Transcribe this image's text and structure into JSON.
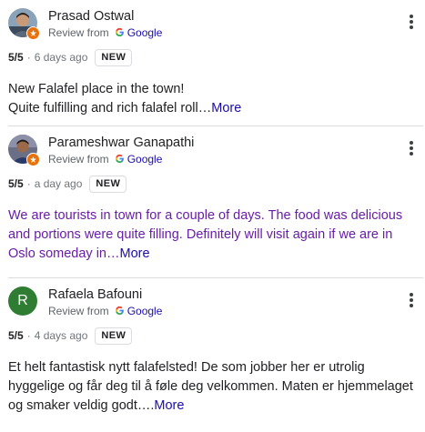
{
  "source_label": "Review from",
  "source_brand": "Google",
  "new_label": "NEW",
  "more_label": "More",
  "reviews": [
    {
      "author": "Prasad Ostwal",
      "rating": "5/5",
      "ago": "6 days ago",
      "text_lines": [
        "New Falafel place in the town!",
        "Quite fulfilling and rich falafel roll…"
      ]
    },
    {
      "author": "Parameshwar Ganapathi",
      "rating": "5/5",
      "ago": "a day ago",
      "text": "We are tourists in town for a couple of days. The food was delicious and portions were quite filling. Definitely will visit again if we are in Oslo someday in…"
    },
    {
      "author": "Rafaela Bafouni",
      "avatar_letter": "R",
      "rating": "5/5",
      "ago": "4 days ago",
      "text": "Et helt fantastisk nytt falafelsted! De som jobber her er utrolig hyggelige og får deg til å føle deg velkommen. Maten er hjemmelaget og smaker veldig godt…."
    }
  ],
  "colors": {
    "link": "#1a0dab",
    "visited_text": "#681da8",
    "local_guide_badge": "#e8710a",
    "letter_avatar": "#2e7d32"
  }
}
